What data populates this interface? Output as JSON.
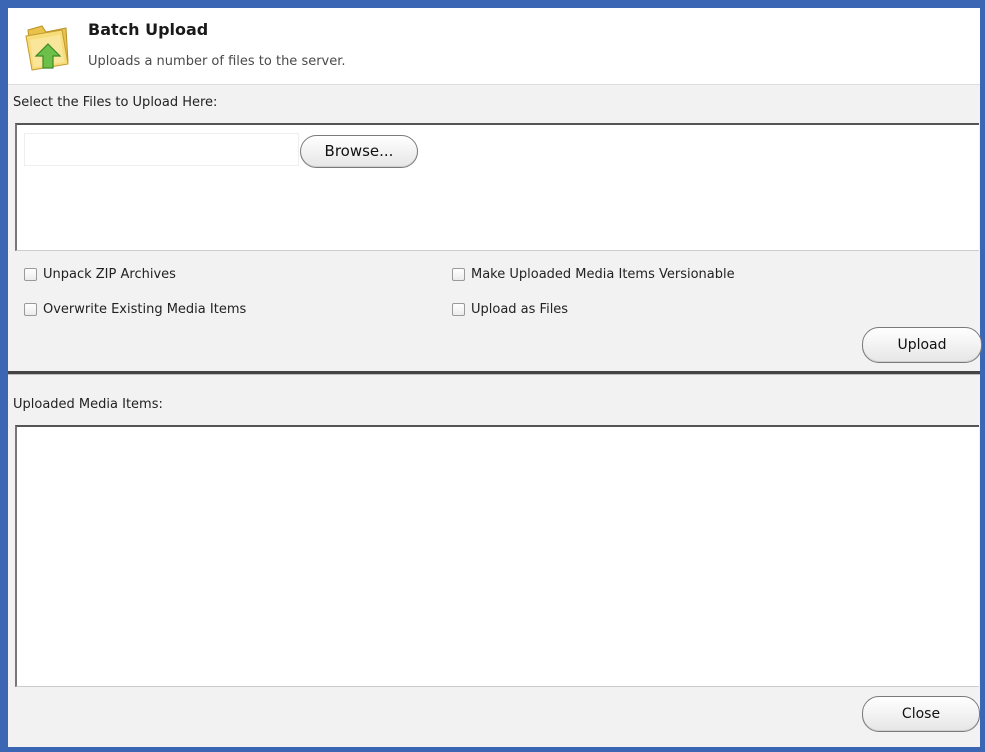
{
  "dialog": {
    "title": "Batch Upload",
    "subtitle": "Uploads a number of files to the server.",
    "icon": "folder-upload-icon"
  },
  "file_section": {
    "label": "Select the Files to Upload Here:",
    "file_input_value": "",
    "browse_label": "Browse..."
  },
  "options": {
    "unpack_zip": {
      "label": "Unpack ZIP Archives",
      "checked": false
    },
    "overwrite": {
      "label": "Overwrite Existing Media Items",
      "checked": false
    },
    "versionable": {
      "label": "Make Uploaded Media Items Versionable",
      "checked": false
    },
    "upload_as_files": {
      "label": "Upload as Files",
      "checked": false
    }
  },
  "upload_label": "Upload",
  "uploaded_section": {
    "label": "Uploaded Media Items:",
    "items": []
  },
  "close_label": "Close",
  "colors": {
    "window_border": "#3b66b4",
    "panel_background": "#f2f2f2",
    "folder_yellow": "#f5d76e",
    "arrow_green": "#5cb85c"
  }
}
